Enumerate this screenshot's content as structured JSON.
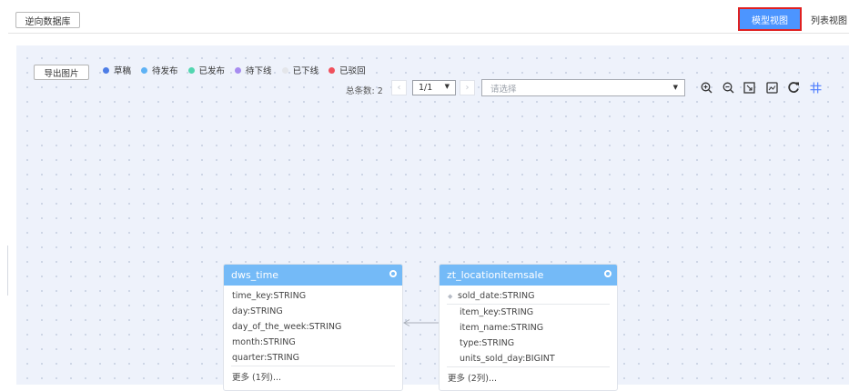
{
  "toolbar": {
    "reverse_db_label": "逆向数据库",
    "model_view_label": "模型视图",
    "list_view_label": "列表视图"
  },
  "canvas": {
    "export_label": "导出图片",
    "legend": [
      {
        "label": "草稿",
        "color": "#4d7de6"
      },
      {
        "label": "待发布",
        "color": "#5eb2f5"
      },
      {
        "label": "已发布",
        "color": "#52d6b0"
      },
      {
        "label": "待下线",
        "color": "#a78cf0"
      },
      {
        "label": "已下线",
        "color": "#e4e6ea"
      },
      {
        "label": "已驳回",
        "color": "#f0505c"
      }
    ],
    "total_label": "总条数: 2",
    "page_value": "1/1",
    "select_placeholder": "请选择",
    "tools": [
      "zoom-in-icon",
      "zoom-out-icon",
      "fit-screen-icon",
      "export-image-icon",
      "refresh-icon",
      "grid-icon"
    ]
  },
  "entities": [
    {
      "name": "dws_time",
      "fields": [
        "time_key:STRING",
        "day:STRING",
        "day_of_the_week:STRING",
        "month:STRING",
        "quarter:STRING"
      ],
      "more": "更多 (1列)..."
    },
    {
      "name": "zt_locationitemsale",
      "key_field": "sold_date:STRING",
      "fields": [
        "item_key:STRING",
        "item_name:STRING",
        "type:STRING",
        "units_sold_day:BIGINT"
      ],
      "more": "更多 (2列)..."
    }
  ],
  "colors": {
    "accent": "#4c95ff",
    "entity_header": "#74baf7",
    "highlight": "#e02020"
  }
}
